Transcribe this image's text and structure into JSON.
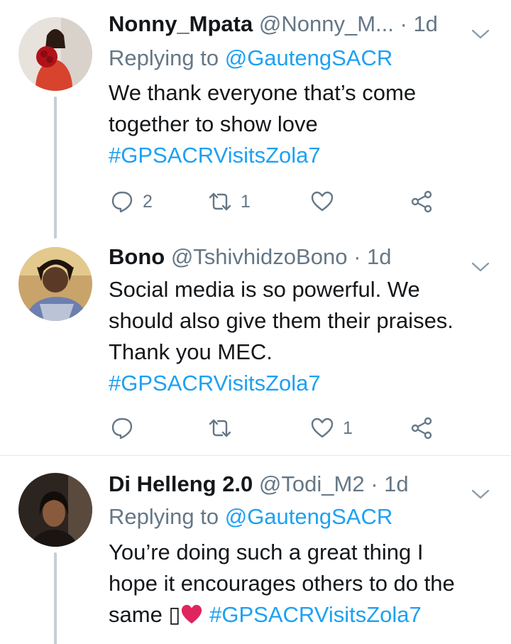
{
  "tweets": [
    {
      "name": "Nonny_Mpata",
      "handle": "@Nonny_M...",
      "dot": "·",
      "time": "1d",
      "replying_prefix": "Replying to ",
      "replying_to": "@GautengSACR",
      "lines": [
        "We thank everyone that’s come",
        "together to show love"
      ],
      "hashtag": "#GPSACRVisitsZola7",
      "replies": "2",
      "retweets": "1",
      "likes": ""
    },
    {
      "name": "Bono",
      "handle": "@TshivhidzoBono",
      "dot": "·",
      "time": "1d",
      "lines": [
        "Social media is so powerful. We",
        "should also give them their praises.",
        "Thank you MEC."
      ],
      "hashtag": "#GPSACRVisitsZola7",
      "replies": "",
      "retweets": "",
      "likes": "1"
    },
    {
      "name": "Di Helleng 2.0",
      "handle": "@Todi_M2",
      "dot": "·",
      "time": "1d",
      "replying_prefix": "Replying to ",
      "replying_to": "@GautengSACR",
      "lines": [
        "You’re doing such a great thing  I",
        "hope it encourages others to do the"
      ],
      "last_line_start": "same ",
      "emoji_box": "▯",
      "hashtag": "#GPSACRVisitsZola7"
    }
  ],
  "colors": {
    "link": "#1da1f2",
    "muted": "#657786",
    "text": "#14171a",
    "heart": "#e0245e",
    "thread": "#c4cfd6"
  },
  "icons": [
    "reply-icon",
    "retweet-icon",
    "like-icon",
    "share-icon",
    "chevron-down-icon"
  ]
}
